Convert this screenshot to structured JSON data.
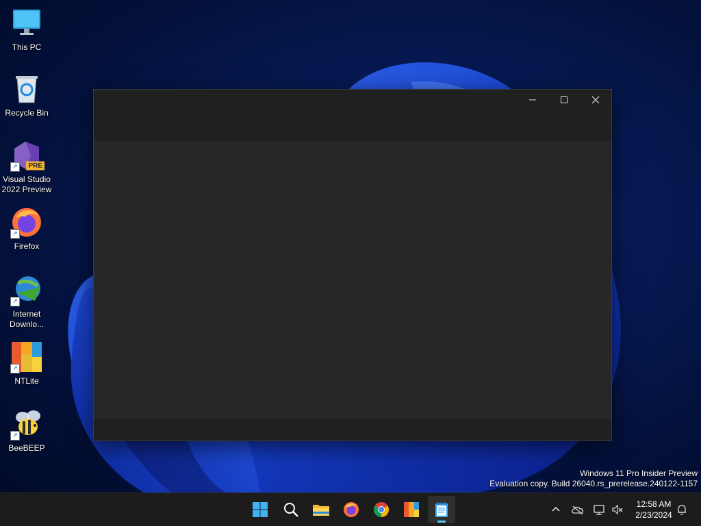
{
  "desktop": {
    "icons": [
      {
        "label": "This PC",
        "icon": "monitor-icon"
      },
      {
        "label": "Recycle Bin",
        "icon": "recycle-bin-icon"
      },
      {
        "label": "Visual Studio\n2022 Preview",
        "icon": "visual-studio-icon",
        "badge": "PRE"
      },
      {
        "label": "Firefox",
        "icon": "firefox-icon"
      },
      {
        "label": "Internet\nDownlo...",
        "icon": "internet-download-manager-icon"
      },
      {
        "label": "NTLite",
        "icon": "ntlite-icon"
      },
      {
        "label": "BeeBEEP",
        "icon": "beebeep-icon"
      }
    ],
    "watermark": {
      "line1": "Windows 11 Pro Insider Preview",
      "line2": "Evaluation copy. Build 26040.rs_prerelease.240122-1157"
    }
  },
  "window": {
    "controls": [
      "minimize",
      "maximize",
      "close"
    ]
  },
  "taskbar": {
    "apps": [
      "start-icon",
      "search-icon",
      "file-explorer-icon",
      "firefox-icon",
      "chrome-icon",
      "ntlite-icon",
      "notepad-icon"
    ],
    "active_app": "notepad-icon",
    "tray": [
      "chevron-up-icon",
      "onedrive-icon",
      "network-icon",
      "volume-muted-icon",
      "notification-bell-icon"
    ],
    "time": "12:58 AM",
    "date": "2/23/2024"
  },
  "colors": {
    "accent": "#60cdff",
    "window_bg": "#272727",
    "taskbar_bg": "#1c1c1c"
  }
}
